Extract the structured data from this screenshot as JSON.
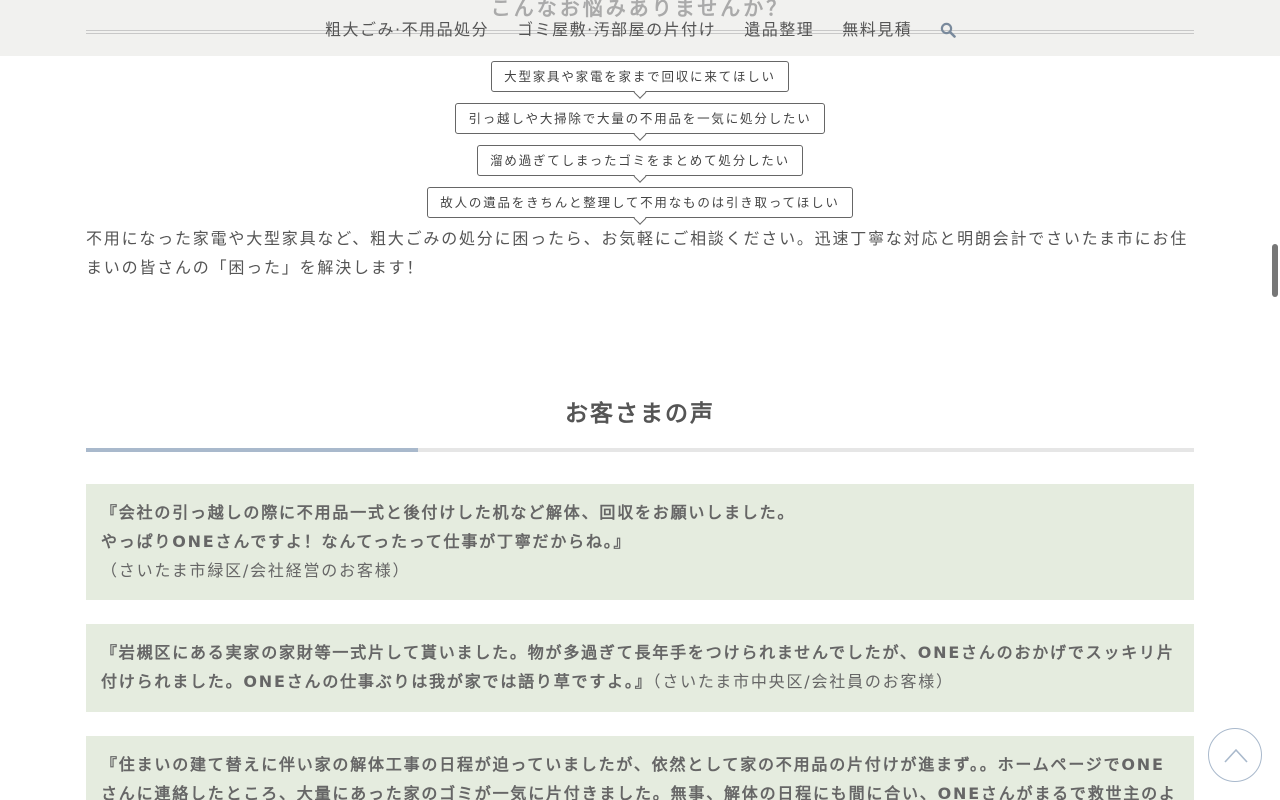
{
  "header": {
    "section_title": "こんなお悩みありませんか？",
    "nav": [
      "粗大ごみ·不用品処分",
      "ゴミ屋敷·汚部屋の片付け",
      "遺品整理",
      "無料見積"
    ],
    "search_icon": "search-icon"
  },
  "worries": [
    "大型家具や家電を家まで回収に来てほしい",
    "引っ越しや大掃除で大量の不用品を一気に処分したい",
    "溜め過ぎてしまったゴミをまとめて処分したい",
    "故人の遺品をきちんと整理して不用なものは引き取ってほしい"
  ],
  "intro": "不用になった家電や大型家具など、粗大ごみの処分に困ったら、お気軽にご相談ください。迅速丁寧な対応と明朗会計でさいたま市にお住まいの皆さんの「困った」を解決します！",
  "voices": {
    "title": "お客さまの声",
    "items": [
      {
        "quote_line1": "『会社の引っ越しの際に不用品一式と後付けした机など解体、回収をお願いしました。",
        "quote_line2": "やっぱりONEさんですよ！なんてったって仕事が丁寧だからね。』",
        "source": "（さいたま市緑区/会社経営のお客様）"
      },
      {
        "quote": "『岩槻区にある実家の家財等一式片して貰いました。物が多過ぎて長年手をつけられませんでしたが、ONEさんのおかげでスッキリ片付けられました。ONEさんの仕事ぶりは我が家では語り草ですよ。』",
        "source": "（さいたま市中央区/会社員のお客様）"
      },
      {
        "quote": "『住まいの建て替えに伴い家の解体工事の日程が迫っていましたが、依然として家の不用品の片付けが進まず。。ホームページでONEさんに連絡したところ、大量にあった家のゴミが一気に片付きました。無事、解体の日程にも間に合い、ONEさんがまるで救世主のようで"
      }
    ]
  },
  "colors": {
    "header_bg": "#f1f1ef",
    "card_bg": "#e5ecdf",
    "accent": "#a9b9cc",
    "text": "#555555"
  }
}
